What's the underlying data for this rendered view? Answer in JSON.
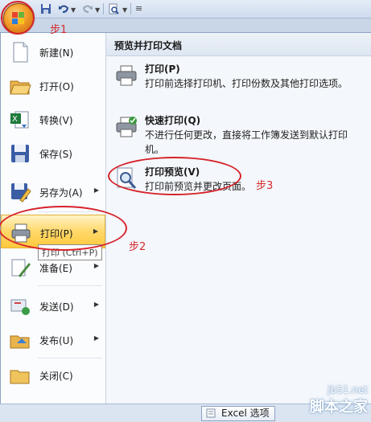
{
  "quick_access": {
    "icons": [
      "office-button",
      "save-icon",
      "undo-icon",
      "redo-icon",
      "print-preview-icon",
      "customize-icon"
    ]
  },
  "menu": {
    "items": [
      {
        "label": "新建(N)",
        "icon": "new-document-icon"
      },
      {
        "label": "打开(O)",
        "icon": "open-folder-icon"
      },
      {
        "label": "转换(V)",
        "icon": "convert-icon"
      },
      {
        "label": "保存(S)",
        "icon": "save-icon"
      },
      {
        "label": "另存为(A)",
        "icon": "save-as-icon"
      },
      {
        "label": "打印(P)",
        "icon": "printer-icon"
      },
      {
        "label": "准备(E)",
        "icon": "prepare-icon"
      },
      {
        "label": "发送(D)",
        "icon": "send-icon"
      },
      {
        "label": "发布(U)",
        "icon": "publish-icon"
      },
      {
        "label": "关闭(C)",
        "icon": "close-folder-icon"
      }
    ],
    "tooltip": "打印 (Ctrl+P)"
  },
  "submenu": {
    "header": "预览并打印文档",
    "options": [
      {
        "title": "打印(P)",
        "desc": "打印前选择打印机、打印份数及其他打印选项。",
        "icon": "printer-icon"
      },
      {
        "title": "快速打印(Q)",
        "desc": "不进行任何更改，直接将工作簿发送到默认打印机。",
        "icon": "quick-print-icon"
      },
      {
        "title": "打印预览(V)",
        "desc": "打印前预览并更改页面。",
        "icon": "magnifier-icon"
      }
    ]
  },
  "bottom": {
    "excel_options": "Excel 选项"
  },
  "annotations": {
    "step1": "步1",
    "step2": "步2",
    "step3": "步3"
  },
  "watermark": {
    "url": "jb51.net",
    "name": "脚本之家"
  },
  "colors": {
    "highlight": "#ffd86a",
    "annotation": "#d42a2a"
  }
}
